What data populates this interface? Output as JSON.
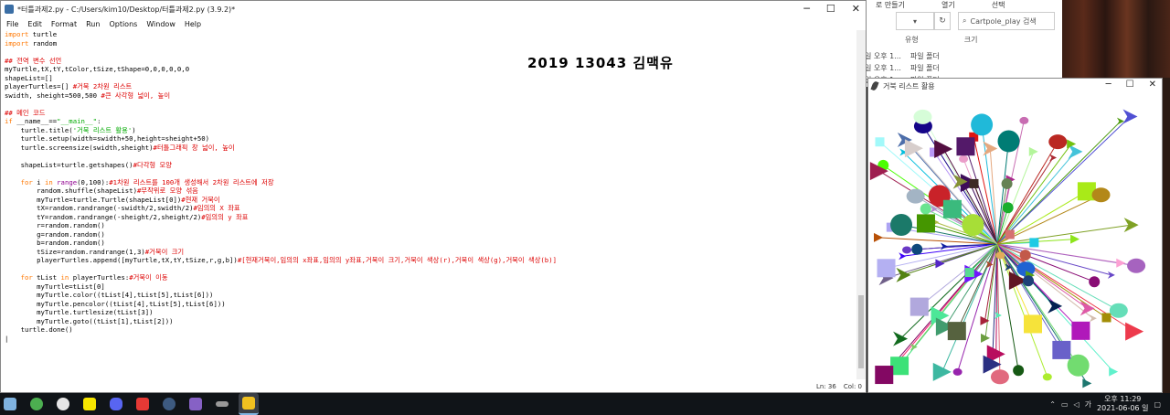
{
  "explorer": {
    "ribbon": [
      "보기",
      "열기",
      "선택"
    ],
    "ribbon_left": "로 만들기",
    "search_placeholder": "Cartpole_play 검색",
    "headers": [
      "유형",
      "크기"
    ],
    "rows": [
      {
        "date": "일 오후 1...",
        "type": "파일 폴더"
      },
      {
        "date": "일 오후 1...",
        "type": "파일 폴더"
      },
      {
        "date": "일 오후 1...",
        "type": "파일 폴더"
      }
    ]
  },
  "editor": {
    "title": "*터틀과제2.py - C:/Users/kim10/Desktop/터틀과제2.py (3.9.2)*",
    "menu": [
      "File",
      "Edit",
      "Format",
      "Run",
      "Options",
      "Window",
      "Help"
    ],
    "status": {
      "line": "Ln: 36",
      "col": "Col: 0"
    },
    "handwriting": "2019 13043 김맥유"
  },
  "turtle_window": {
    "title": "거북 리스트 활용"
  },
  "taskbar": {
    "apps": [
      {
        "name": "explorer",
        "color": "#7fb3e0"
      },
      {
        "name": "app-green",
        "color": "#4caf50"
      },
      {
        "name": "app-chat",
        "color": "#e6e6e6"
      },
      {
        "name": "kakaotalk",
        "color": "#f7e600"
      },
      {
        "name": "discord",
        "color": "#5865f2"
      },
      {
        "name": "app-red",
        "color": "#e53935"
      },
      {
        "name": "steam",
        "color": "#1b2838"
      },
      {
        "name": "visual-studio",
        "color": "#8661c5"
      },
      {
        "name": "app-bar",
        "color": "#999999"
      },
      {
        "name": "python-idle",
        "color": "#f0c020"
      }
    ],
    "tray_ime": "가",
    "time": "오후 11:29",
    "date": "2021-06-06 일"
  }
}
